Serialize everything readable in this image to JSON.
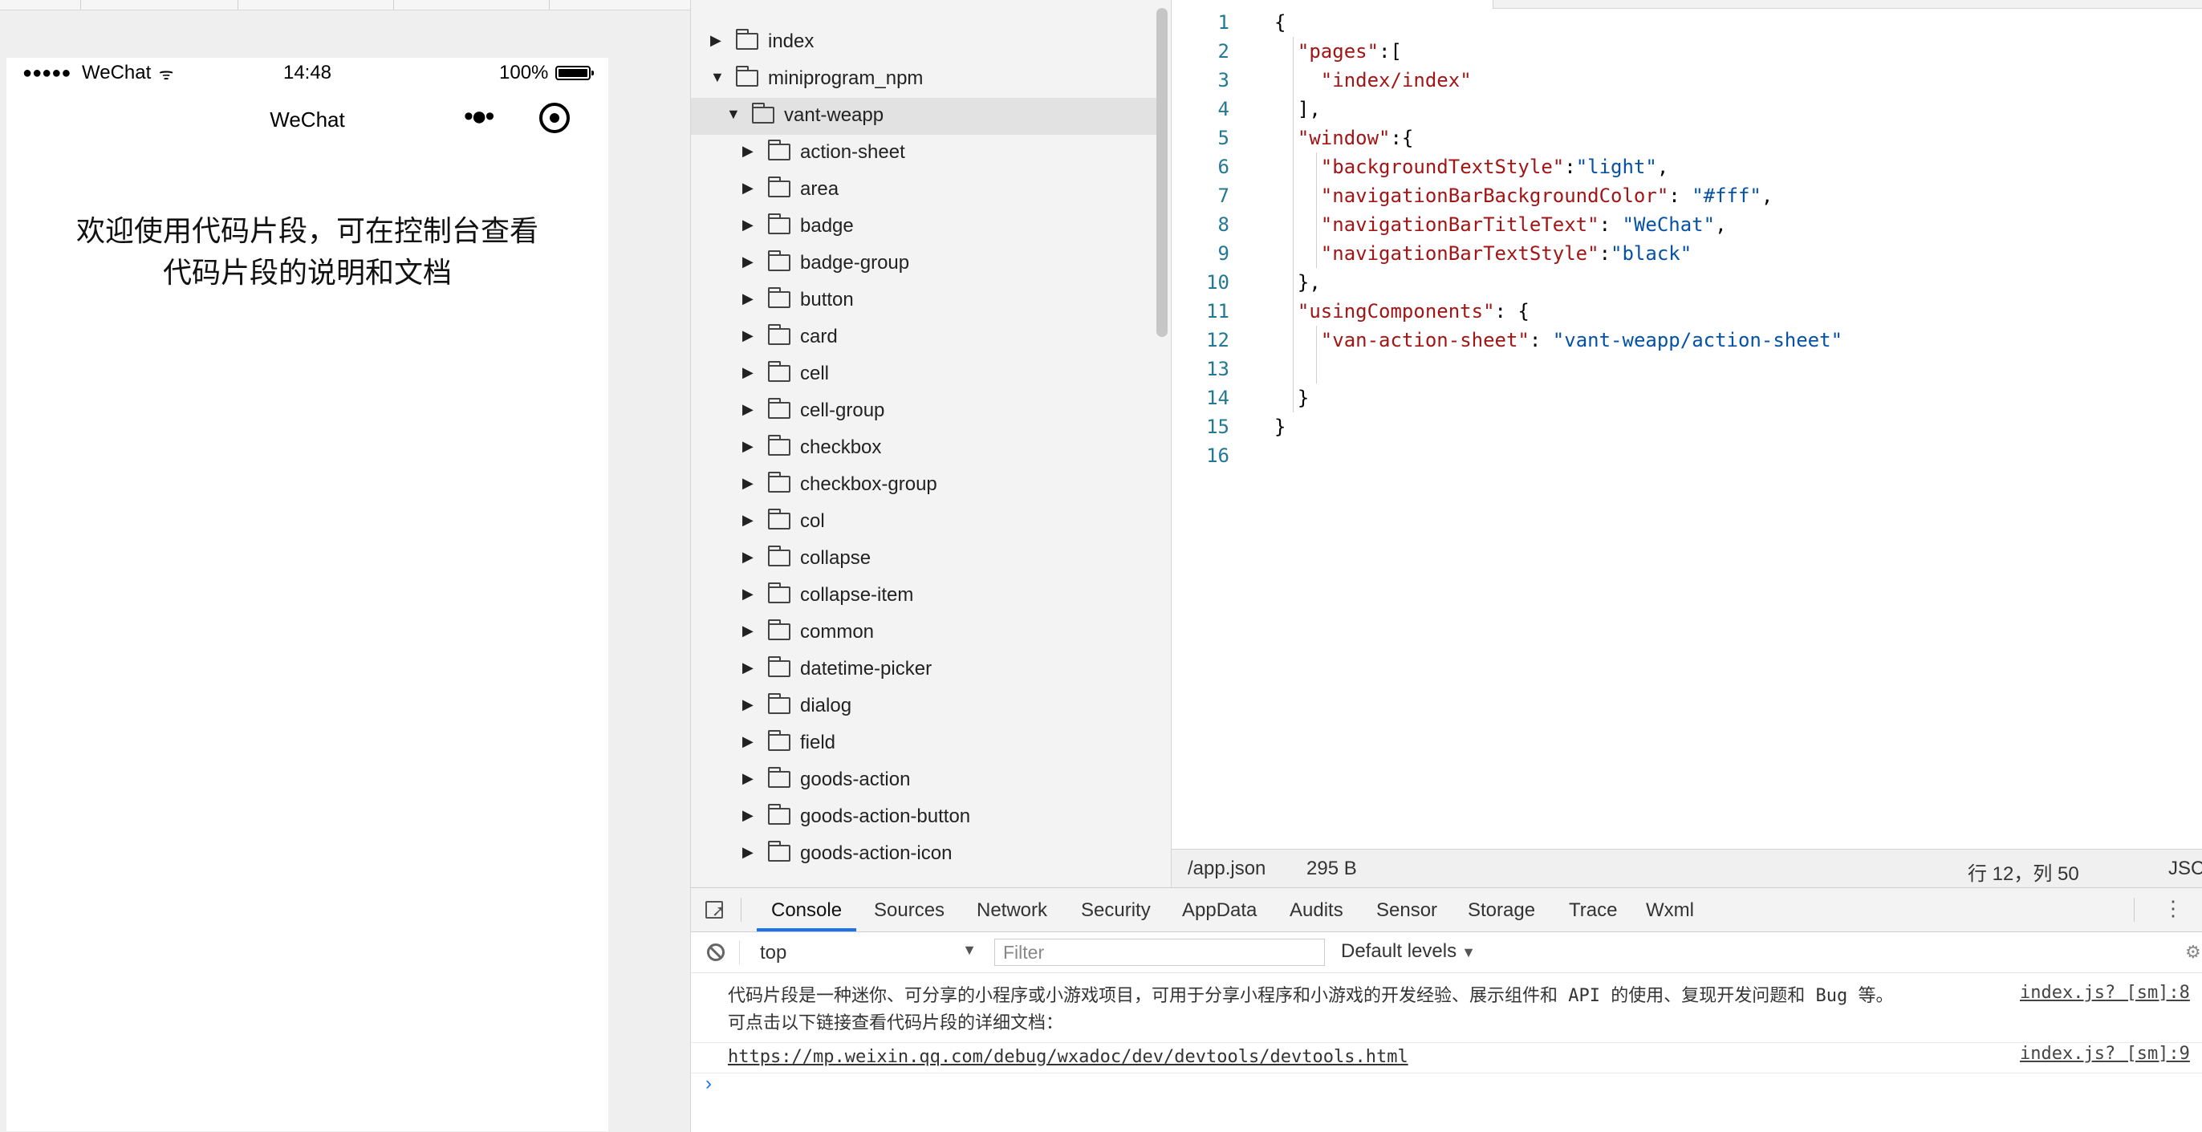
{
  "simulator": {
    "status_bar": {
      "signal": "●●●●●",
      "carrier": "WeChat",
      "wifi": "ᯤ",
      "time": "14:48",
      "battery": "100%"
    },
    "nav": {
      "title": "WeChat",
      "more": "•●•"
    },
    "welcome_line1": "欢迎使用代码片段，可在控制台查看",
    "welcome_line2": "代码片段的说明和文档"
  },
  "tree": {
    "items": [
      {
        "label": "index",
        "depth": 0,
        "expanded": false
      },
      {
        "label": "miniprogram_npm",
        "depth": 0,
        "expanded": true
      },
      {
        "label": "vant-weapp",
        "depth": 1,
        "expanded": true,
        "selected": true
      },
      {
        "label": "action-sheet",
        "depth": 2,
        "expanded": false
      },
      {
        "label": "area",
        "depth": 2,
        "expanded": false
      },
      {
        "label": "badge",
        "depth": 2,
        "expanded": false
      },
      {
        "label": "badge-group",
        "depth": 2,
        "expanded": false
      },
      {
        "label": "button",
        "depth": 2,
        "expanded": false
      },
      {
        "label": "card",
        "depth": 2,
        "expanded": false
      },
      {
        "label": "cell",
        "depth": 2,
        "expanded": false
      },
      {
        "label": "cell-group",
        "depth": 2,
        "expanded": false
      },
      {
        "label": "checkbox",
        "depth": 2,
        "expanded": false
      },
      {
        "label": "checkbox-group",
        "depth": 2,
        "expanded": false
      },
      {
        "label": "col",
        "depth": 2,
        "expanded": false
      },
      {
        "label": "collapse",
        "depth": 2,
        "expanded": false
      },
      {
        "label": "collapse-item",
        "depth": 2,
        "expanded": false
      },
      {
        "label": "common",
        "depth": 2,
        "expanded": false
      },
      {
        "label": "datetime-picker",
        "depth": 2,
        "expanded": false
      },
      {
        "label": "dialog",
        "depth": 2,
        "expanded": false
      },
      {
        "label": "field",
        "depth": 2,
        "expanded": false
      },
      {
        "label": "goods-action",
        "depth": 2,
        "expanded": false
      },
      {
        "label": "goods-action-button",
        "depth": 2,
        "expanded": false
      },
      {
        "label": "goods-action-icon",
        "depth": 2,
        "expanded": false
      }
    ]
  },
  "editor": {
    "lines": [
      {
        "n": "1",
        "indent": 0,
        "parts": [
          [
            "p",
            "{"
          ]
        ]
      },
      {
        "n": "2",
        "indent": 1,
        "parts": [
          [
            "k",
            "\"pages\""
          ],
          [
            "p",
            ":["
          ]
        ]
      },
      {
        "n": "3",
        "indent": 2,
        "parts": [
          [
            "k",
            "\"index/index\""
          ]
        ]
      },
      {
        "n": "4",
        "indent": 1,
        "parts": [
          [
            "p",
            "],"
          ]
        ]
      },
      {
        "n": "5",
        "indent": 1,
        "parts": [
          [
            "k",
            "\"window\""
          ],
          [
            "p",
            ":{"
          ]
        ]
      },
      {
        "n": "6",
        "indent": 2,
        "parts": [
          [
            "k",
            "\"backgroundTextStyle\""
          ],
          [
            "p",
            ":"
          ],
          [
            "s",
            "\"light\""
          ],
          [
            "p",
            ","
          ]
        ]
      },
      {
        "n": "7",
        "indent": 2,
        "parts": [
          [
            "k",
            "\"navigationBarBackgroundColor\""
          ],
          [
            "p",
            ": "
          ],
          [
            "s",
            "\"#fff\""
          ],
          [
            "p",
            ","
          ]
        ]
      },
      {
        "n": "8",
        "indent": 2,
        "parts": [
          [
            "k",
            "\"navigationBarTitleText\""
          ],
          [
            "p",
            ": "
          ],
          [
            "s",
            "\"WeChat\""
          ],
          [
            "p",
            ","
          ]
        ]
      },
      {
        "n": "9",
        "indent": 2,
        "parts": [
          [
            "k",
            "\"navigationBarTextStyle\""
          ],
          [
            "p",
            ":"
          ],
          [
            "s",
            "\"black\""
          ]
        ]
      },
      {
        "n": "10",
        "indent": 1,
        "parts": [
          [
            "p",
            "},"
          ]
        ]
      },
      {
        "n": "11",
        "indent": 1,
        "parts": [
          [
            "k",
            "\"usingComponents\""
          ],
          [
            "p",
            ": {"
          ]
        ]
      },
      {
        "n": "12",
        "indent": 2,
        "parts": [
          [
            "k",
            "\"van-action-sheet\""
          ],
          [
            "p",
            ": "
          ],
          [
            "s",
            "\"vant-weapp/action-sheet\""
          ]
        ]
      },
      {
        "n": "13",
        "indent": 2,
        "parts": []
      },
      {
        "n": "14",
        "indent": 1,
        "parts": [
          [
            "p",
            "}"
          ]
        ]
      },
      {
        "n": "15",
        "indent": 0,
        "parts": [
          [
            "p",
            "}"
          ]
        ]
      },
      {
        "n": "16",
        "indent": 0,
        "parts": []
      }
    ],
    "status": {
      "path": "/app.json",
      "size": "295 B",
      "position": "行 12，列 50",
      "lang": "JSC"
    }
  },
  "devtools": {
    "tabs": [
      "Console",
      "Sources",
      "Network",
      "Security",
      "AppData",
      "Audits",
      "Sensor",
      "Storage",
      "Trace",
      "Wxml"
    ],
    "active_tab": "Console",
    "context": "top",
    "filter_placeholder": "Filter",
    "levels": "Default levels",
    "logs": [
      {
        "message": "代码片段是一种迷你、可分享的小程序或小游戏项目，可用于分享小程序和小游戏的开发经验、展示组件和 API 的使用、复现开发问题和 Bug 等。可点击以下链接查看代码片段的详细文档：",
        "source": "index.js? [sm]:8"
      },
      {
        "message": "https://mp.weixin.qq.com/debug/wxadoc/dev/devtools/devtools.html",
        "source": "index.js? [sm]:9"
      }
    ],
    "prompt": "›"
  },
  "colors": {
    "json_key": "#a31515",
    "json_string": "#0451a5",
    "line_number": "#237893",
    "accent": "#1a73e8"
  }
}
